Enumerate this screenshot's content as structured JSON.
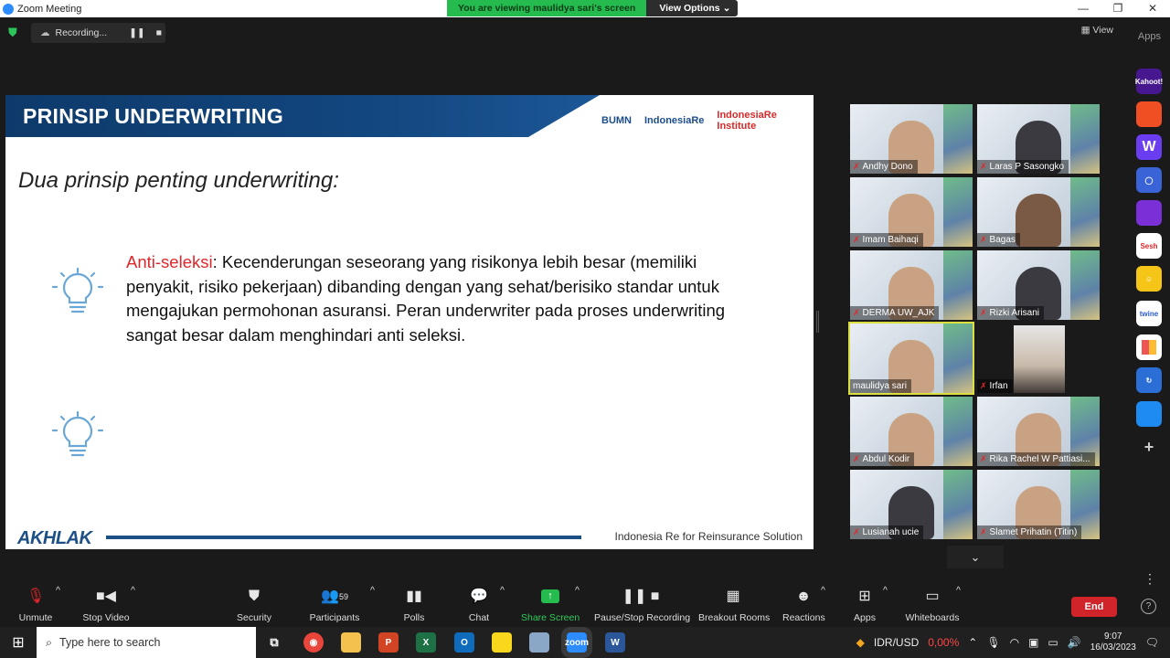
{
  "window": {
    "title": "Zoom Meeting"
  },
  "share_banner": {
    "message": "You are viewing maulidya sari's screen",
    "view_options": "View Options"
  },
  "recording": {
    "label": "Recording..."
  },
  "top_right": {
    "view": "View",
    "apps": "Apps"
  },
  "slide": {
    "header_title": "PRINSIP UNDERWRITING",
    "logos": [
      "BUMN",
      "IndonesiaRe",
      "IndonesiaRe Institute"
    ],
    "subtitle": "Dua prinsip penting underwriting:",
    "term": "Anti-seleksi",
    "body": ": Kecenderungan seseorang yang risikonya lebih besar (memiliki penyakit, risiko pekerjaan) dibanding dengan yang sehat/berisiko standar untuk mengajukan permohonan asuransi. Peran underwriter pada proses underwriting sangat besar dalam menghindari anti seleksi.",
    "footer_logo": "AKHLAK",
    "footer_text": "Indonesia Re for Reinsurance Solution"
  },
  "participants_grid": [
    {
      "name": "Andhy Dono",
      "muted": true
    },
    {
      "name": "Laras P Sasongko",
      "muted": true
    },
    {
      "name": "Imam Baihaqi",
      "muted": true
    },
    {
      "name": "Bagas",
      "muted": true
    },
    {
      "name": "DERMA UW_AJK",
      "muted": true
    },
    {
      "name": "Rizki Arisani",
      "muted": true
    },
    {
      "name": "maulidya sari",
      "muted": false
    },
    {
      "name": "Irfan",
      "muted": true
    },
    {
      "name": "Abdul Kodir",
      "muted": true
    },
    {
      "name": "Rika Rachel W Pattiasi...",
      "muted": true
    },
    {
      "name": "Lusianah ucie",
      "muted": true
    },
    {
      "name": "Slamet Prihatin (Titin)",
      "muted": true
    }
  ],
  "apps_panel": [
    "Kahoot!",
    "",
    "W",
    "",
    "",
    "Sesh",
    "",
    "twine",
    "",
    "",
    ""
  ],
  "toolbar": {
    "unmute": "Unmute",
    "stop_video": "Stop Video",
    "security": "Security",
    "participants": "Participants",
    "participants_count": "59",
    "polls": "Polls",
    "chat": "Chat",
    "share_screen": "Share Screen",
    "pause_stop_recording": "Pause/Stop Recording",
    "breakout_rooms": "Breakout Rooms",
    "reactions": "Reactions",
    "apps": "Apps",
    "whiteboards": "Whiteboards",
    "end": "End"
  },
  "taskbar": {
    "search_placeholder": "Type here to search",
    "currency": "IDR/USD",
    "currency_change": "0,00%",
    "time": "9:07",
    "date": "16/03/2023"
  },
  "colors": {
    "zoom_blue": "#2d8cff",
    "share_green": "#26bb4f",
    "end_red": "#d1232a",
    "slide_navy": "#12467e",
    "accent_red": "#e0262a"
  }
}
